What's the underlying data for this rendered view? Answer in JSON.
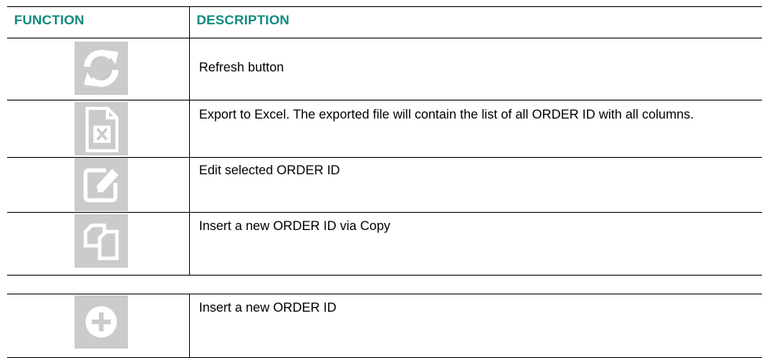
{
  "header": {
    "function": "FUNCTION",
    "description": "DESCRIPTION"
  },
  "rows": [
    {
      "icon": "refresh-icon",
      "description": "Refresh button"
    },
    {
      "icon": "excel-file-icon",
      "description": "Export to Excel.  The exported file will contain the list of all ORDER ID with all columns."
    },
    {
      "icon": "edit-icon",
      "description": "Edit selected ORDER ID"
    },
    {
      "icon": "copy-icon",
      "description": "Insert a new ORDER ID via Copy"
    },
    {
      "icon": "add-circle-icon",
      "description": "Insert a new ORDER ID"
    }
  ],
  "colors": {
    "header_text": "#0e8b80",
    "icon_tile": "#cbcbcb",
    "icon_glyph": "#ffffff"
  }
}
